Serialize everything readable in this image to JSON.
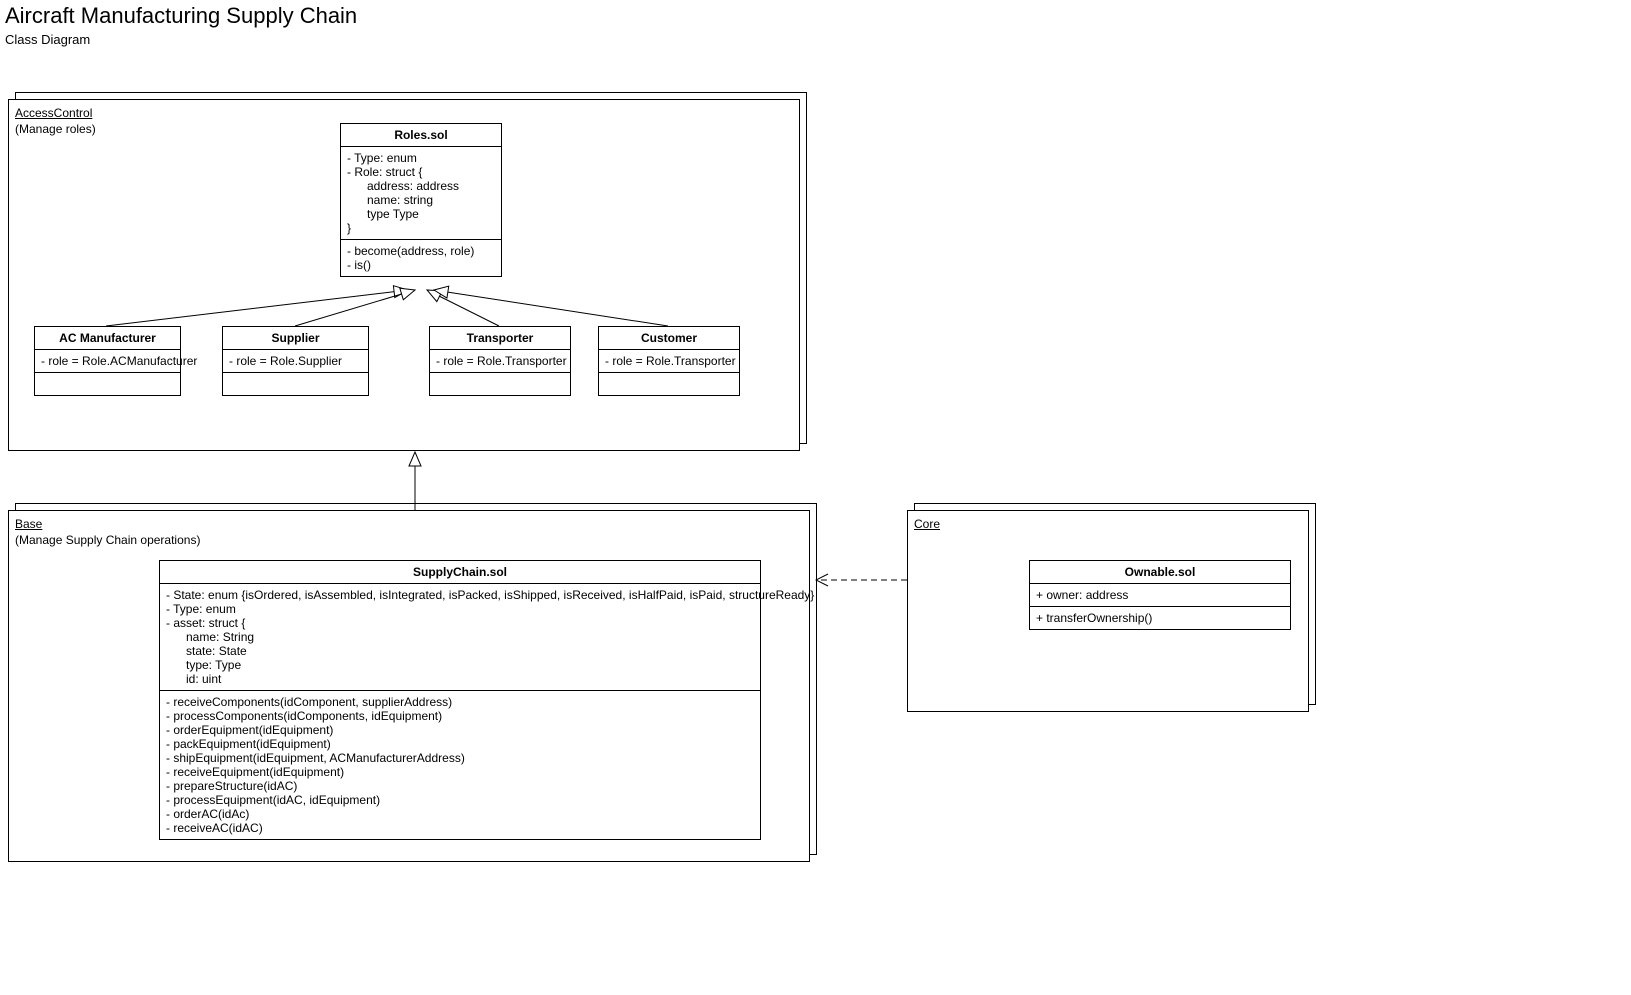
{
  "title": "Aircraft Manufacturing Supply Chain",
  "subtitle": "Class Diagram",
  "packages": {
    "accessControl": {
      "name": "AccessControl",
      "desc": "(Manage roles)"
    },
    "base": {
      "name": "Base",
      "desc": "(Manage Supply Chain operations)"
    },
    "core": {
      "name": "Core",
      "desc": ""
    }
  },
  "classes": {
    "roles": {
      "name": "Roles.sol",
      "attrs": "- Type: enum\n- Role: struct {\n      address: address\n      name: string\n      type Type\n}",
      "ops": "- become(address, role)\n- is()"
    },
    "acManufacturer": {
      "name": "AC Manufacturer",
      "attrs": "- role = Role.ACManufacturer",
      "ops": " "
    },
    "supplier": {
      "name": "Supplier",
      "attrs": "- role = Role.Supplier",
      "ops": " "
    },
    "transporter": {
      "name": "Transporter",
      "attrs": "- role = Role.Transporter",
      "ops": " "
    },
    "customer": {
      "name": "Customer",
      "attrs": "- role = Role.Transporter",
      "ops": " "
    },
    "supplyChain": {
      "name": "SupplyChain.sol",
      "attrs": "- State: enum {isOrdered, isAssembled, isIntegrated, isPacked, isShipped, isReceived, isHalfPaid, isPaid, structureReady}\n- Type: enum\n- asset: struct {\n      name: String\n      state: State\n      type: Type\n      id: uint",
      "ops": "- receiveComponents(idComponent, supplierAddress)\n- processComponents(idComponents, idEquipment)\n- orderEquipment(idEquipment)\n- packEquipment(idEquipment)\n- shipEquipment(idEquipment, ACManufacturerAddress)\n- receiveEquipment(idEquipment)\n- prepareStructure(idAC)\n- processEquipment(idAC, idEquipment)\n- orderAC(idAc)\n- receiveAC(idAC)"
    },
    "ownable": {
      "name": "Ownable.sol",
      "attrs": "+ owner: address",
      "ops": "+ transferOwnership()"
    }
  }
}
